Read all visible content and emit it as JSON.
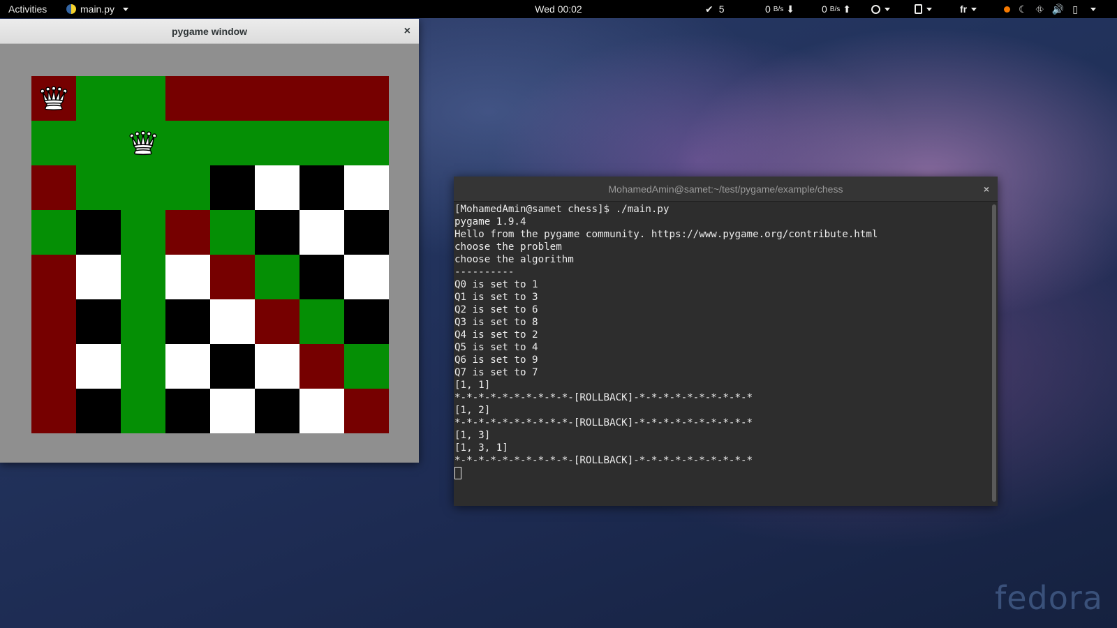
{
  "topbar": {
    "activities": "Activities",
    "app_name": "main.py",
    "clock": "Wed 00:02",
    "check_count": "5",
    "net_down": "0",
    "net_down_unit": "B/s",
    "net_up": "0",
    "net_up_unit": "B/s",
    "language": "fr"
  },
  "pygame": {
    "title": "pygame window",
    "close": "×",
    "board": [
      [
        "rq",
        "g",
        "g",
        "r",
        "r",
        "r",
        "r",
        "r"
      ],
      [
        "g",
        "g",
        "gq",
        "g",
        "g",
        "g",
        "g",
        "g"
      ],
      [
        "r",
        "g",
        "g",
        "g",
        "b",
        "w",
        "b",
        "w"
      ],
      [
        "g",
        "b",
        "g",
        "r",
        "g",
        "b",
        "w",
        "b"
      ],
      [
        "r",
        "w",
        "g",
        "w",
        "r",
        "g",
        "b",
        "w"
      ],
      [
        "r",
        "b",
        "g",
        "b",
        "w",
        "r",
        "g",
        "b"
      ],
      [
        "r",
        "w",
        "g",
        "w",
        "b",
        "w",
        "r",
        "g"
      ],
      [
        "r",
        "b",
        "g",
        "b",
        "w",
        "b",
        "w",
        "r"
      ]
    ],
    "colors": {
      "green": "#058f05",
      "red": "#760000",
      "white": "#ffffff",
      "black": "#000000"
    }
  },
  "terminal": {
    "title": "MohamedAmin@samet:~/test/pygame/example/chess",
    "close": "×",
    "lines": [
      "[MohamedAmin@samet chess]$ ./main.py",
      "pygame 1.9.4",
      "Hello from the pygame community. https://www.pygame.org/contribute.html",
      "choose the problem",
      "choose the algorithm",
      "----------",
      "Q0 is set to 1",
      "Q1 is set to 3",
      "Q2 is set to 6",
      "Q3 is set to 8",
      "Q4 is set to 2",
      "Q5 is set to 4",
      "Q6 is set to 9",
      "Q7 is set to 7",
      "[1, 1]",
      "*-*-*-*-*-*-*-*-*-*-[ROLLBACK]-*-*-*-*-*-*-*-*-*-*",
      "[1, 2]",
      "*-*-*-*-*-*-*-*-*-*-[ROLLBACK]-*-*-*-*-*-*-*-*-*-*",
      "[1, 3]",
      "[1, 3, 1]",
      "*-*-*-*-*-*-*-*-*-*-[ROLLBACK]-*-*-*-*-*-*-*-*-*-*"
    ]
  },
  "watermark": "fedora"
}
